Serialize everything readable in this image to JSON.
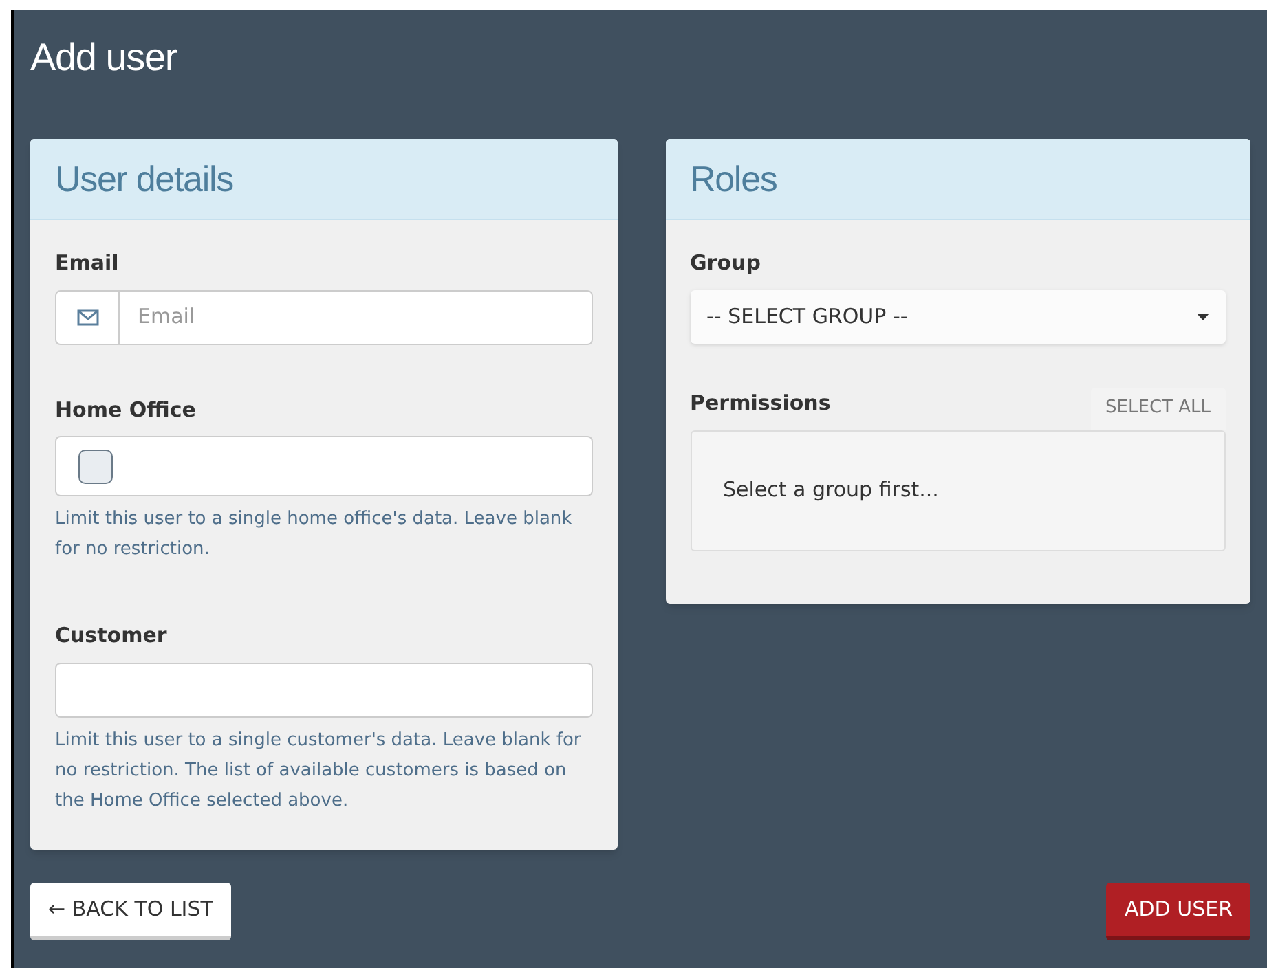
{
  "page_title": "Add user",
  "user_details": {
    "title": "User details",
    "email": {
      "label": "Email",
      "placeholder": "Email"
    },
    "home_office": {
      "label": "Home Office",
      "checked": false,
      "help": "Limit this user to a single home office's data. Leave blank for no restriction."
    },
    "customer": {
      "label": "Customer",
      "help": "Limit this user to a single customer's data. Leave blank for no restriction. The list of available customers is based on the Home Office selected above."
    }
  },
  "roles": {
    "title": "Roles",
    "group": {
      "label": "Group",
      "value": "-- SELECT GROUP --"
    },
    "permissions": {
      "label": "Permissions",
      "select_all": "SELECT ALL",
      "empty_text": "Select a group first..."
    }
  },
  "buttons": {
    "back": "← BACK TO LIST",
    "add": "ADD USER"
  }
}
